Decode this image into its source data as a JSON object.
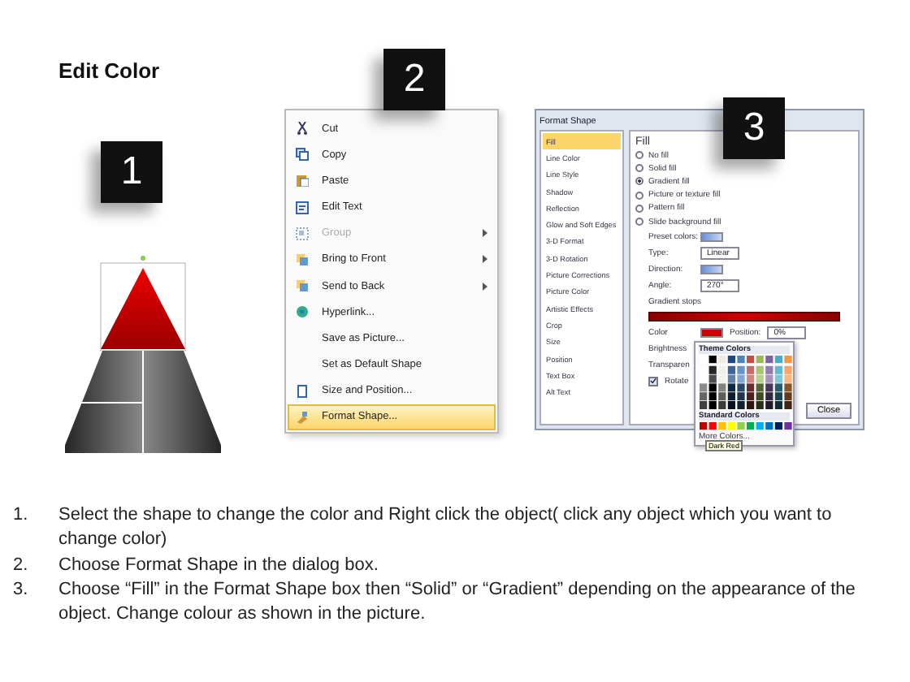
{
  "title": "Edit Color",
  "steps": [
    {
      "badge": "1"
    },
    {
      "badge": "2"
    },
    {
      "badge": "3"
    }
  ],
  "context_menu": {
    "items": [
      {
        "label": "Cut",
        "disabled": false,
        "submenu": false,
        "selected": false,
        "kind": "scissors"
      },
      {
        "label": "Copy",
        "disabled": false,
        "submenu": false,
        "selected": false,
        "kind": "copy"
      },
      {
        "label": "Paste",
        "disabled": false,
        "submenu": false,
        "selected": false,
        "kind": "paste"
      },
      {
        "label": "Edit Text",
        "disabled": false,
        "submenu": false,
        "selected": false,
        "kind": "text"
      },
      {
        "label": "Group",
        "disabled": true,
        "submenu": true,
        "selected": false,
        "kind": "group"
      },
      {
        "label": "Bring to Front",
        "disabled": false,
        "submenu": true,
        "selected": false,
        "kind": "order"
      },
      {
        "label": "Send to Back",
        "disabled": false,
        "submenu": true,
        "selected": false,
        "kind": "order"
      },
      {
        "label": "Hyperlink...",
        "disabled": false,
        "submenu": false,
        "selected": false,
        "kind": "link"
      },
      {
        "label": "Save as Picture...",
        "disabled": false,
        "submenu": false,
        "selected": false,
        "kind": "plain"
      },
      {
        "label": "Set as Default Shape",
        "disabled": false,
        "submenu": false,
        "selected": false,
        "kind": "plain"
      },
      {
        "label": "Size and Position...",
        "disabled": false,
        "submenu": false,
        "selected": false,
        "kind": "size"
      },
      {
        "label": "Format Shape...",
        "disabled": false,
        "submenu": false,
        "selected": true,
        "kind": "format"
      }
    ]
  },
  "dialog": {
    "title": "Format Shape",
    "categories": [
      {
        "label": "Fill",
        "selected": true
      },
      {
        "label": "Line Color",
        "selected": false
      },
      {
        "label": "Line Style",
        "selected": false
      },
      {
        "label": "Shadow",
        "selected": false
      },
      {
        "label": "Reflection",
        "selected": false
      },
      {
        "label": "Glow and Soft Edges",
        "selected": false
      },
      {
        "label": "3-D Format",
        "selected": false
      },
      {
        "label": "3-D Rotation",
        "selected": false
      },
      {
        "label": "Picture Corrections",
        "selected": false
      },
      {
        "label": "Picture Color",
        "selected": false
      },
      {
        "label": "Artistic Effects",
        "selected": false
      },
      {
        "label": "Crop",
        "selected": false
      },
      {
        "label": "Size",
        "selected": false
      },
      {
        "label": "Position",
        "selected": false
      },
      {
        "label": "Text Box",
        "selected": false
      },
      {
        "label": "Alt Text",
        "selected": false
      }
    ],
    "heading": "Fill",
    "fill_options": [
      {
        "label": "No fill",
        "selected": false
      },
      {
        "label": "Solid fill",
        "selected": false
      },
      {
        "label": "Gradient fill",
        "selected": true
      },
      {
        "label": "Picture or texture fill",
        "selected": false
      },
      {
        "label": "Pattern fill",
        "selected": false
      },
      {
        "label": "Slide background fill",
        "selected": false
      }
    ],
    "preset_colors_label": "Preset colors:",
    "type_label": "Type:",
    "type_value": "Linear",
    "direction_label": "Direction:",
    "angle_label": "Angle:",
    "angle_value": "270°",
    "gradient_stops_label": "Gradient stops",
    "color_label": "Color",
    "position_label": "Position:",
    "position_value": "0%",
    "brightness_label": "Brightness",
    "transparency_label": "Transparen",
    "rotate": {
      "label": "Rotate",
      "checked": true
    },
    "close_button": "Close",
    "palette": {
      "theme_label": "Theme Colors",
      "standard_label": "Standard Colors",
      "more_label": "More Colors...",
      "tooltip": "Dark Red"
    }
  },
  "instructions": [
    {
      "number": "1.",
      "text": "Select the shape to change the color and Right click the object( click any object which you want to change color)"
    },
    {
      "number": "2.",
      "text": "Choose Format Shape in the dialog box."
    },
    {
      "number": "3.",
      "text": "Choose “Fill” in the Format Shape box then “Solid” or “Gradient” depending on the appearance of the object. Change colour as shown in the picture."
    }
  ]
}
